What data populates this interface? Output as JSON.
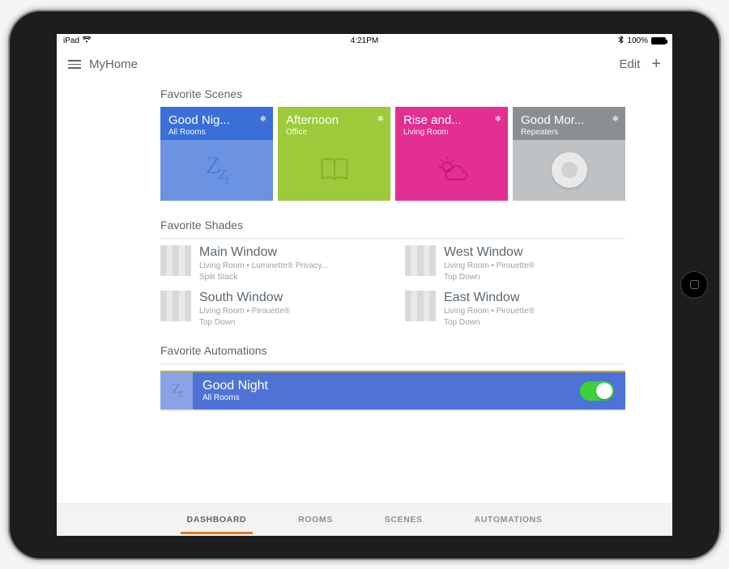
{
  "statusbar": {
    "device": "iPad",
    "time": "4:21PM",
    "battery": "100%"
  },
  "header": {
    "title": "MyHome",
    "edit": "Edit"
  },
  "sections": {
    "scenes_title": "Favorite Scenes",
    "shades_title": "Favorite Shades",
    "automations_title": "Favorite Automations"
  },
  "scenes": [
    {
      "name": "Good Nig...",
      "sub": "All Rooms",
      "icon": "sleep-zz-icon"
    },
    {
      "name": "Afternoon",
      "sub": "Office",
      "icon": "book-icon"
    },
    {
      "name": "Rise and...",
      "sub": "Living Room",
      "icon": "sun-cloud-icon"
    },
    {
      "name": "Good Mor...",
      "sub": "Repeaters",
      "icon": "repeater-icon"
    }
  ],
  "shades": [
    {
      "name": "Main Window",
      "line1": "Living Room • Luminette® Privacy...",
      "line2": "Split Stack"
    },
    {
      "name": "West Window",
      "line1": "Living Room • Pirouette®",
      "line2": "Top Down"
    },
    {
      "name": "South Window",
      "line1": "Living Room • Pirouette®",
      "line2": "Top Down"
    },
    {
      "name": "East Window",
      "line1": "Living Room • Pirouette®",
      "line2": "Top Down"
    }
  ],
  "automations": [
    {
      "name": "Good Night",
      "sub": "All Rooms",
      "enabled": true
    }
  ],
  "tabs": {
    "dashboard": "DASHBOARD",
    "rooms": "ROOMS",
    "scenes": "SCENES",
    "automations": "AUTOMATIONS",
    "active": "dashboard"
  },
  "colors": {
    "scene_blue": "#3a6fd8",
    "scene_green": "#9dca3a",
    "scene_pink": "#e22f91",
    "scene_gray": "#8c8f92",
    "accent_orange": "#e37a1e",
    "toggle_green": "#3bd13b"
  }
}
